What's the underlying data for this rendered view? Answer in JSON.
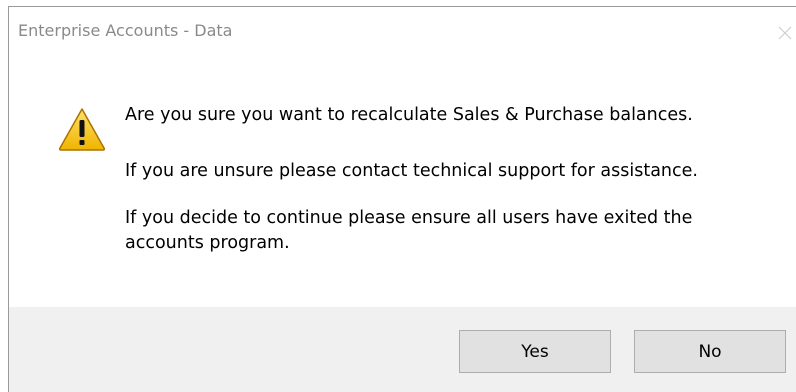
{
  "window": {
    "title": "Enterprise Accounts - Data"
  },
  "icons": {
    "close": "close-icon",
    "warning": "warning-icon"
  },
  "message": {
    "line1": "Are you sure you want to recalculate Sales & Purchase balances.",
    "line2": "If you are unsure please contact technical support for assistance.",
    "line3a": "If you decide to continue please ensure all users have exited the",
    "line3b": "accounts program."
  },
  "buttons": {
    "yes": "Yes",
    "no": "No"
  },
  "colors": {
    "warning_fill": "#f7c81b",
    "warning_outline": "#b07a00",
    "footer_bg": "#f0f0f0",
    "button_bg": "#e1e1e1",
    "button_border": "#adadad",
    "title_text": "#8a8a8a"
  }
}
